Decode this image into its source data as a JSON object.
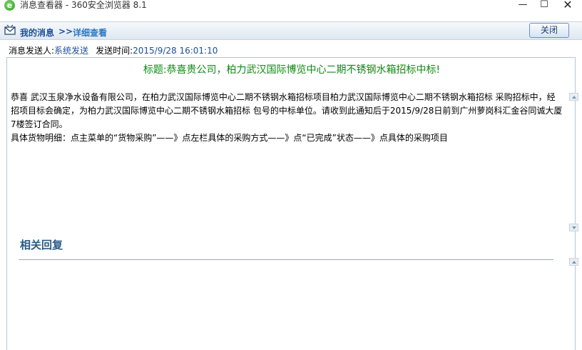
{
  "window": {
    "app_icon_glyph": "e",
    "title": "消息查看器 - 360安全浏览器 8.1",
    "minimize": "—",
    "maximize": "☐",
    "close": "✕"
  },
  "header": {
    "home_label": "我的消息",
    "separator": ">>",
    "current_label": "详细查看",
    "close_button": "关闭"
  },
  "meta": {
    "sender_label": "消息发送人:",
    "sender_value": "系统发送",
    "time_label": "发送时间:",
    "time_value": "2015/9/28 16:01:10"
  },
  "message": {
    "title": "标题:恭喜贵公司，柏力武汉国际博览中心二期不锈钢水箱招标中标!",
    "body_line1": "恭喜 武汉玉泉净水设备有限公司，在柏力武汉国际博览中心二期不锈钢水箱招标项目柏力武汉国际博览中心二期不锈钢水箱招标 采购招标中，经招项目标会确定，为柏力武汉国际博览中心二期不锈钢水箱招标 包号的中标单位。请收到此通知后于2015/9/28日前到广州萝岗科汇金谷同诚大厦7楼签订合同。",
    "body_line2": "具体货物明细：点主菜单的“货物采购”——》点左栏具体的采购方式——》点“已完成”状态——》点具体的采购项目"
  },
  "replies": {
    "heading": "相关回复"
  },
  "colors": {
    "title_green": "#0e8a12",
    "link_blue": "#1c4f97",
    "heading_blue": "#2a5b86"
  },
  "icons": [
    "app-logo-icon",
    "mail-icon",
    "minimize-icon",
    "maximize-icon",
    "close-icon",
    "scroll-up-icon",
    "scroll-down-icon"
  ]
}
